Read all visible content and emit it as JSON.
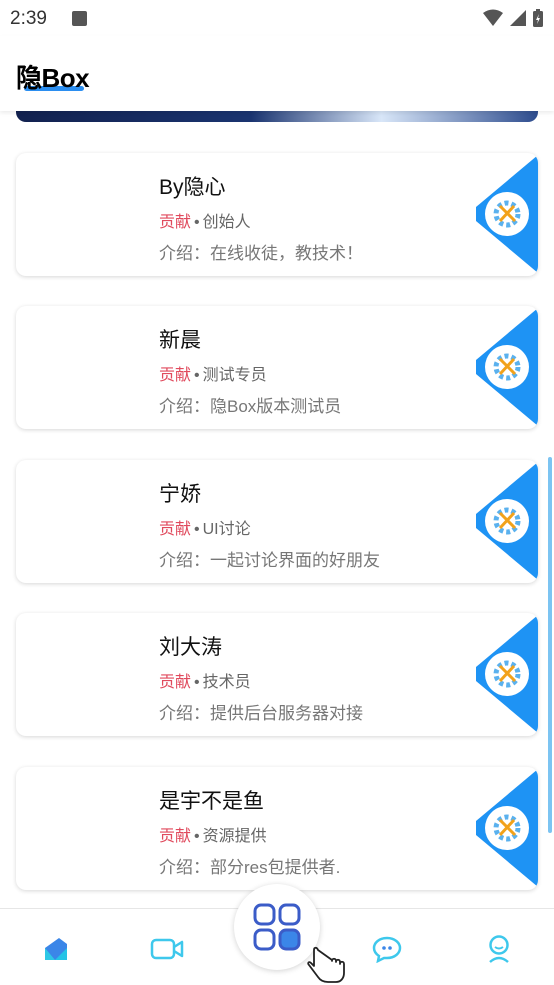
{
  "status_bar": {
    "time": "2:39"
  },
  "app_bar": {
    "title": "隐Box"
  },
  "members": [
    {
      "name": "By隐心",
      "tag": "贡献",
      "role": "创始人",
      "intro": "介绍：在线收徒，教技术！"
    },
    {
      "name": "新晨",
      "tag": "贡献",
      "role": "测试专员",
      "intro": "介绍：隐Box版本测试员"
    },
    {
      "name": "宁娇",
      "tag": "贡献",
      "role": "UI讨论",
      "intro": "介绍：一起讨论界面的好朋友"
    },
    {
      "name": "刘大涛",
      "tag": "贡献",
      "role": "技术员",
      "intro": "介绍：提供后台服务器对接"
    },
    {
      "name": "是宇不是鱼",
      "tag": "贡献",
      "role": "资源提供",
      "intro": "介绍：部分res包提供者."
    }
  ],
  "separator": "•",
  "bottom_nav": {
    "items": [
      "home-icon",
      "video-icon",
      "apps-icon",
      "chat-icon",
      "profile-icon"
    ],
    "active": "home-icon"
  },
  "colors": {
    "accent": "#2b8ef0",
    "badge": "#1e93f4",
    "tag": "#e04a5d"
  }
}
